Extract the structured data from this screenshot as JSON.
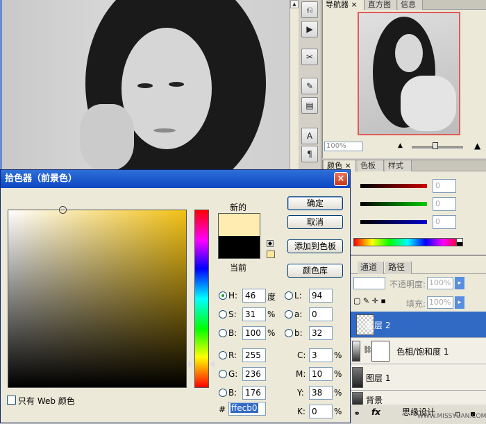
{
  "navigator": {
    "tabs": [
      "导航器",
      "直方图",
      "信息"
    ],
    "tab_close": "×",
    "zoom": "100%"
  },
  "color_panel": {
    "tabs": [
      "颜色",
      "色板",
      "样式"
    ],
    "values": [
      "0",
      "0",
      "0"
    ]
  },
  "layers_panel": {
    "tabs": [
      "通道",
      "路径"
    ],
    "opacity_label": "不透明度:",
    "opacity_value": "100%",
    "fill_label": "填充:",
    "fill_value": "100%",
    "layers": [
      "图层 2",
      "色相/饱和度 1",
      "图层 1",
      "背景"
    ],
    "footer_label": "思缘设计"
  },
  "picker": {
    "title": "拾色器（前景色）",
    "close": "×",
    "new_label": "新的",
    "current_label": "当前",
    "new_color": "#ffecb0",
    "current_color": "#000000",
    "buttons": {
      "ok": "确定",
      "cancel": "取消",
      "add_swatch": "添加到色板",
      "libraries": "颜色库"
    },
    "fields": {
      "H": {
        "label": "H:",
        "value": "46",
        "unit": "度"
      },
      "S": {
        "label": "S:",
        "value": "31",
        "unit": "%"
      },
      "Bv": {
        "label": "B:",
        "value": "100",
        "unit": "%"
      },
      "R": {
        "label": "R:",
        "value": "255"
      },
      "G": {
        "label": "G:",
        "value": "236"
      },
      "B": {
        "label": "B:",
        "value": "176"
      },
      "L": {
        "label": "L:",
        "value": "94"
      },
      "a": {
        "label": "a:",
        "value": "0"
      },
      "b": {
        "label": "b:",
        "value": "32"
      },
      "C": {
        "label": "C:",
        "value": "3",
        "unit": "%"
      },
      "M": {
        "label": "M:",
        "value": "10",
        "unit": "%"
      },
      "Y": {
        "label": "Y:",
        "value": "38",
        "unit": "%"
      },
      "K": {
        "label": "K:",
        "value": "0",
        "unit": "%"
      }
    },
    "hex_prefix": "#",
    "hex": "ffecb0",
    "web_only_label": "只有 Web 颜色"
  },
  "watermark": "WWW.MISSYUAN.COM"
}
